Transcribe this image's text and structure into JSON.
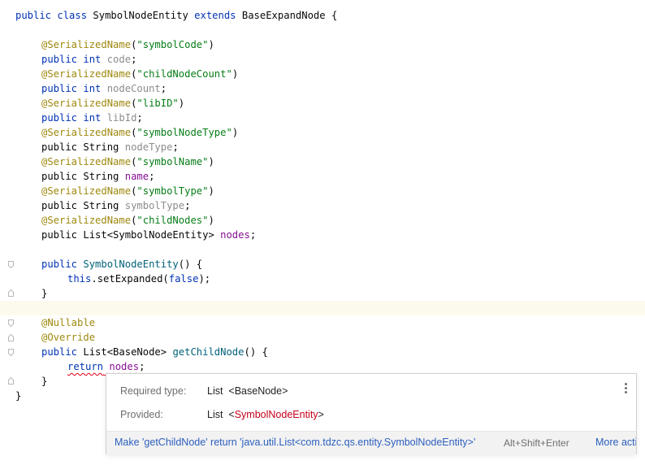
{
  "code": {
    "class_decl": {
      "kw1": "public",
      "kw2": "class",
      "name": "SymbolNodeEntity",
      "kw3": "extends",
      "parent": "BaseExpandNode",
      "brace": "{"
    },
    "fields": [
      {
        "annotation": "@SerializedName",
        "arg": "\"symbolCode\"",
        "mods": "public int ",
        "field": "code"
      },
      {
        "annotation": "@SerializedName",
        "arg": "\"childNodeCount\"",
        "mods": "public int ",
        "field": "nodeCount"
      },
      {
        "annotation": "@SerializedName",
        "arg": "\"libID\"",
        "mods": "public int ",
        "field": "libId"
      },
      {
        "annotation": "@SerializedName",
        "arg": "\"symbolNodeType\"",
        "mods": "public String ",
        "field": "nodeType"
      },
      {
        "annotation": "@SerializedName",
        "arg": "\"symbolName\"",
        "mods": "public String ",
        "field": "name"
      },
      {
        "annotation": "@SerializedName",
        "arg": "\"symbolType\"",
        "mods": "public String ",
        "field": "symbolType"
      },
      {
        "annotation": "@SerializedName",
        "arg": "\"childNodes\"",
        "mods": "public List<SymbolNodeEntity> ",
        "field": "nodes"
      }
    ],
    "constructor": {
      "kw": "public",
      "name": "SymbolNodeEntity",
      "sig": "() {",
      "this_kw": "this",
      "call": ".setExpanded(",
      "false_kw": "false",
      "call_end": ");",
      "close": "}"
    },
    "method": {
      "ann1": "@Nullable",
      "ann2": "@Override",
      "kw": "public",
      "type": "List<BaseNode> ",
      "name": "getChildNode",
      "sig": "() {",
      "return_kw": "return",
      "return_val": "nodes",
      "return_end": ";",
      "close": "}"
    },
    "class_close": "}"
  },
  "popup": {
    "required_label": "Required type:",
    "required_value": "List",
    "required_generic": "<BaseNode>",
    "provided_label": "Provided:",
    "provided_value": "List",
    "provided_generic_open": "<",
    "provided_generic_type": "SymbolNodeEntity",
    "provided_generic_close": ">",
    "fix_action": "Make 'getChildNode' return 'java.util.List<com.tdzc.qs.entity.SymbolNodeEntity>'",
    "fix_shortcut": "Alt+Shift+Enter",
    "more_actions": "More actions"
  }
}
